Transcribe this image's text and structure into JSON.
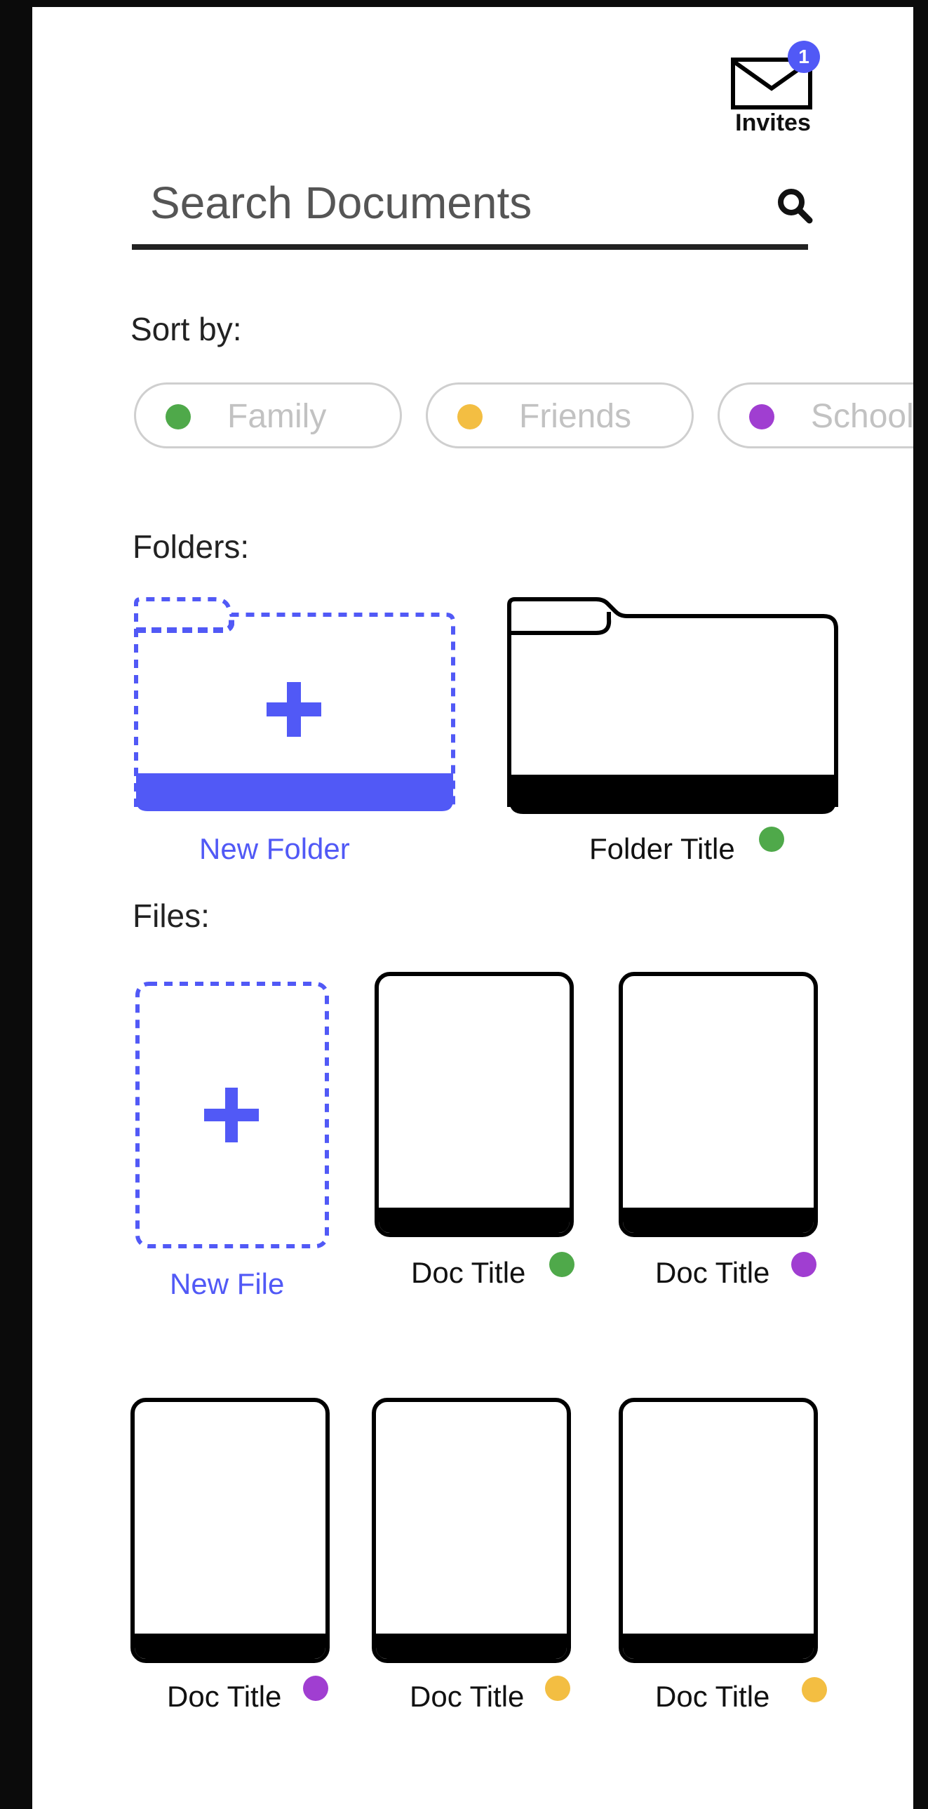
{
  "colors": {
    "accent": "#5159f6",
    "green": "#4fa94a",
    "yellow": "#f3be42",
    "purple": "#a03ed1"
  },
  "invites": {
    "label": "Invites",
    "badge_count": "1",
    "icon": "envelope-icon"
  },
  "search": {
    "placeholder": "Search Documents",
    "icon": "search-icon"
  },
  "sort": {
    "label": "Sort by:",
    "chips": [
      {
        "label": "Family",
        "color": "#4fa94a"
      },
      {
        "label": "Friends",
        "color": "#f3be42"
      },
      {
        "label": "School",
        "color": "#a03ed1"
      }
    ]
  },
  "folders": {
    "label": "Folders:",
    "new_label": "New Folder",
    "items": [
      {
        "title": "Folder Title",
        "color": "#4fa94a"
      }
    ]
  },
  "files": {
    "label": "Files:",
    "new_label": "New File",
    "items": [
      {
        "title": "Doc Title",
        "color": "#4fa94a"
      },
      {
        "title": "Doc Title",
        "color": "#a03ed1"
      },
      {
        "title": "Doc Title",
        "color": "#a03ed1"
      },
      {
        "title": "Doc Title",
        "color": "#f3be42"
      },
      {
        "title": "Doc Title",
        "color": "#f3be42"
      }
    ]
  }
}
